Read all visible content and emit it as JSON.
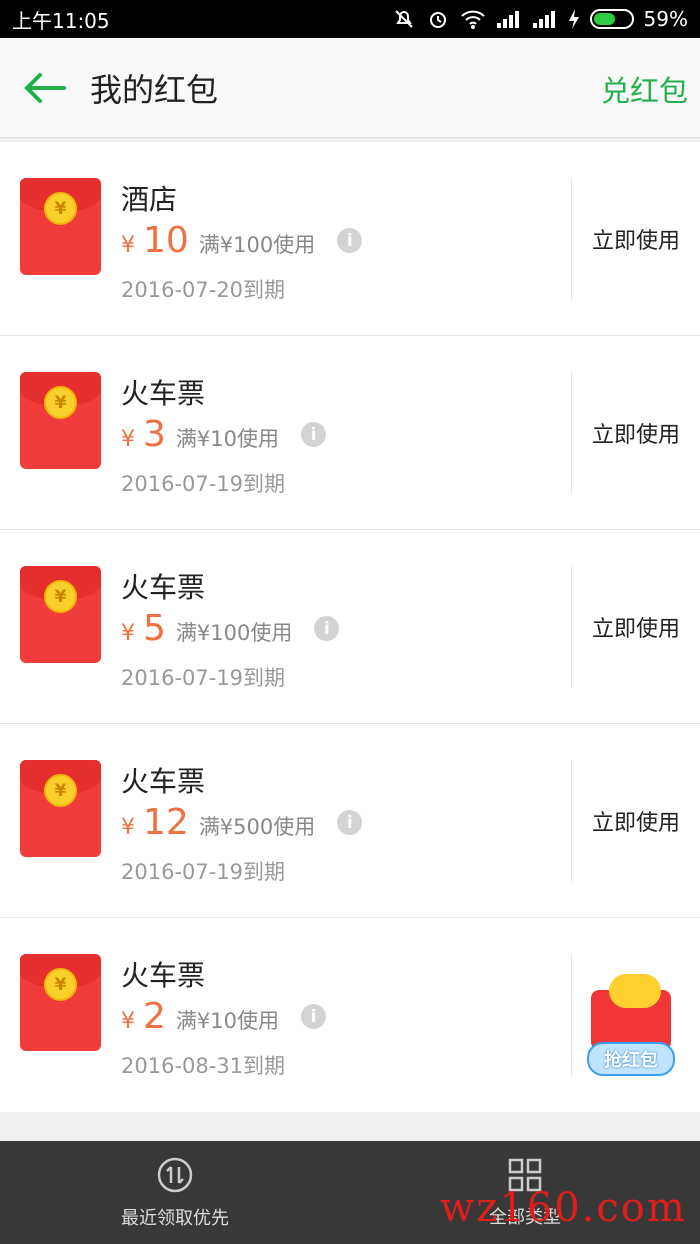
{
  "status_bar": {
    "time": "上午11:05",
    "battery": "59%",
    "icons": [
      "mute-icon",
      "alarm-icon",
      "wifi-icon",
      "signal-icon",
      "signal-icon",
      "charging-icon",
      "battery-icon"
    ]
  },
  "header": {
    "title": "我的红包",
    "redeem_label": "兑红包",
    "back_icon": "back-arrow-icon"
  },
  "envelope_symbol": "¥",
  "items": [
    {
      "name": "酒店",
      "currency": "¥",
      "amount": "10",
      "condition": "满¥100使用",
      "expire": "2016-07-20到期",
      "action": "立即使用"
    },
    {
      "name": "火车票",
      "currency": "¥",
      "amount": "3",
      "condition": "满¥10使用",
      "expire": "2016-07-19到期",
      "action": "立即使用"
    },
    {
      "name": "火车票",
      "currency": "¥",
      "amount": "5",
      "condition": "满¥100使用",
      "expire": "2016-07-19到期",
      "action": "立即使用"
    },
    {
      "name": "火车票",
      "currency": "¥",
      "amount": "12",
      "condition": "满¥500使用",
      "expire": "2016-07-19到期",
      "action": "立即使用"
    },
    {
      "name": "火车票",
      "currency": "¥",
      "amount": "2",
      "condition": "满¥10使用",
      "expire": "2016-08-31到期",
      "action": ""
    }
  ],
  "grab_badge": {
    "label": "抢红包"
  },
  "bottom_bar": {
    "tabs": [
      {
        "label": "最近领取优先",
        "icon": "sort-icon"
      },
      {
        "label": "全部类型",
        "icon": "grid-icon"
      }
    ]
  },
  "watermark": "wz160.com",
  "colors": {
    "accent": "#21b04b",
    "price": "#f07040",
    "envelope": "#f13c3c"
  }
}
